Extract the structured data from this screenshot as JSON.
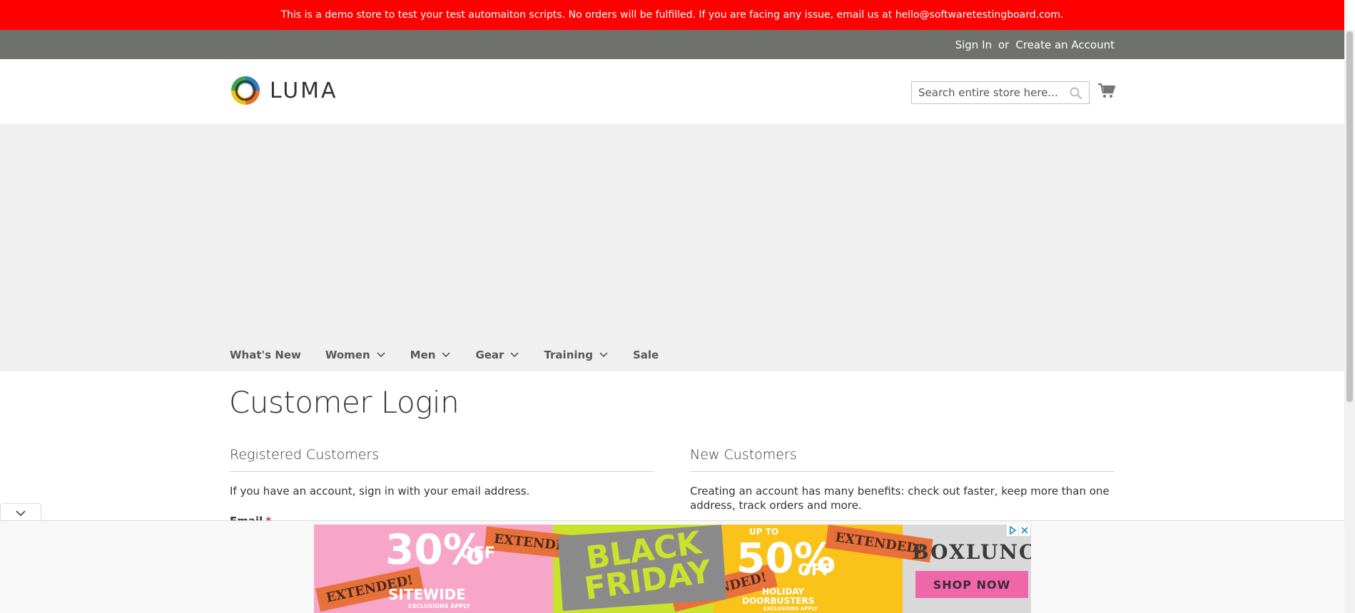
{
  "notice": {
    "text": "This is a demo store to test your test automaiton scripts. No orders will be fulfilled. If you are facing any issue, email us at hello@softwaretestingboard.com."
  },
  "header_links": {
    "sign_in": "Sign In",
    "or": "or",
    "create_account": "Create an Account"
  },
  "logo": {
    "text": "LUMA"
  },
  "search": {
    "placeholder": "Search entire store here..."
  },
  "nav": {
    "items": [
      {
        "label": "What's New",
        "has_dropdown": false
      },
      {
        "label": "Women",
        "has_dropdown": true
      },
      {
        "label": "Men",
        "has_dropdown": true
      },
      {
        "label": "Gear",
        "has_dropdown": true
      },
      {
        "label": "Training",
        "has_dropdown": true
      },
      {
        "label": "Sale",
        "has_dropdown": false
      }
    ]
  },
  "page": {
    "title": "Customer Login"
  },
  "registered": {
    "title": "Registered Customers",
    "text": "If you have an account, sign in with your email address.",
    "email_label": "Email",
    "required_mark": "*"
  },
  "new_customers": {
    "title": "New Customers",
    "text": "Creating an account has many benefits: check out faster, keep more than one address, track orders and more."
  },
  "ad": {
    "tag_text": "EXTENDED!",
    "left_value": "30%",
    "left_off": "OFF",
    "left_sub": "SITEWIDE",
    "left_fine": "EXCLUSIONS APPLY",
    "center_line1": "BLACK",
    "center_line2": "FRIDAY",
    "right_upto": "UP TO",
    "right_value": "50%",
    "right_off": "OFF",
    "right_sub1": "HOLIDAY",
    "right_sub2": "DOORBUSTERS",
    "right_fine": "EXCLUSIONS APPLY",
    "brand": "BOXLUNCH",
    "cta": "SHOP NOW"
  },
  "colors": {
    "notice_bg": "#ff0000",
    "panel_bg": "#6e716e",
    "nav_band_bg": "#f0f0f0",
    "required": "#e02b27"
  }
}
